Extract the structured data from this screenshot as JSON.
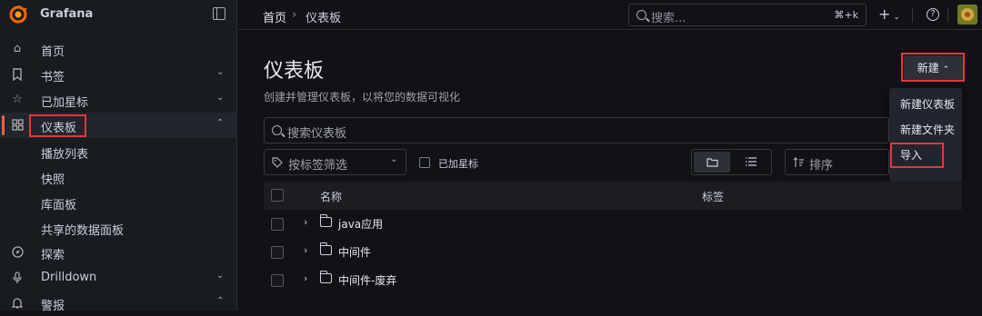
{
  "app": {
    "name": "Grafana"
  },
  "sidebar": {
    "items": [
      {
        "label": "首页",
        "icon": "home-icon"
      },
      {
        "label": "书签",
        "icon": "bookmark-icon",
        "expandable": true
      },
      {
        "label": "已加星标",
        "icon": "star-icon",
        "expandable": true
      },
      {
        "label": "仪表板",
        "icon": "apps-icon",
        "expanded": true,
        "active": true
      },
      {
        "label": "探索",
        "icon": "compass-icon"
      },
      {
        "label": "Drilldown",
        "icon": "microphone-icon",
        "expandable": true
      },
      {
        "label": "警报",
        "icon": "bell-icon",
        "expanded": true
      }
    ],
    "sub_items": [
      "播放列表",
      "快照",
      "库面板",
      "共享的数据面板"
    ]
  },
  "topbar": {
    "breadcrumb": [
      "首页",
      "仪表板"
    ],
    "breadcrumb_sep": "›",
    "search_placeholder": "搜索...",
    "search_shortcut": "⌘+k",
    "add_label": "+",
    "help_label": "?"
  },
  "main": {
    "title": "仪表板",
    "subtitle": "创建并管理仪表板，以将您的数据可视化",
    "new_button": "新建",
    "new_menu": [
      "新建仪表板",
      "新建文件夹",
      "导入"
    ],
    "search_placeholder": "搜索仪表板",
    "tag_filter_placeholder": "按标签筛选",
    "starred_label": "已加星标",
    "sort_placeholder": "排序",
    "columns": {
      "name": "名称",
      "tags": "标签"
    },
    "rows": [
      {
        "name": "java应用"
      },
      {
        "name": "中间件"
      },
      {
        "name": "中间件-废弃"
      }
    ]
  },
  "colors": {
    "accent": "#f55f3e",
    "highlight_box": "#e0383a",
    "background": "#111217",
    "sidebar": "#181b1f"
  }
}
